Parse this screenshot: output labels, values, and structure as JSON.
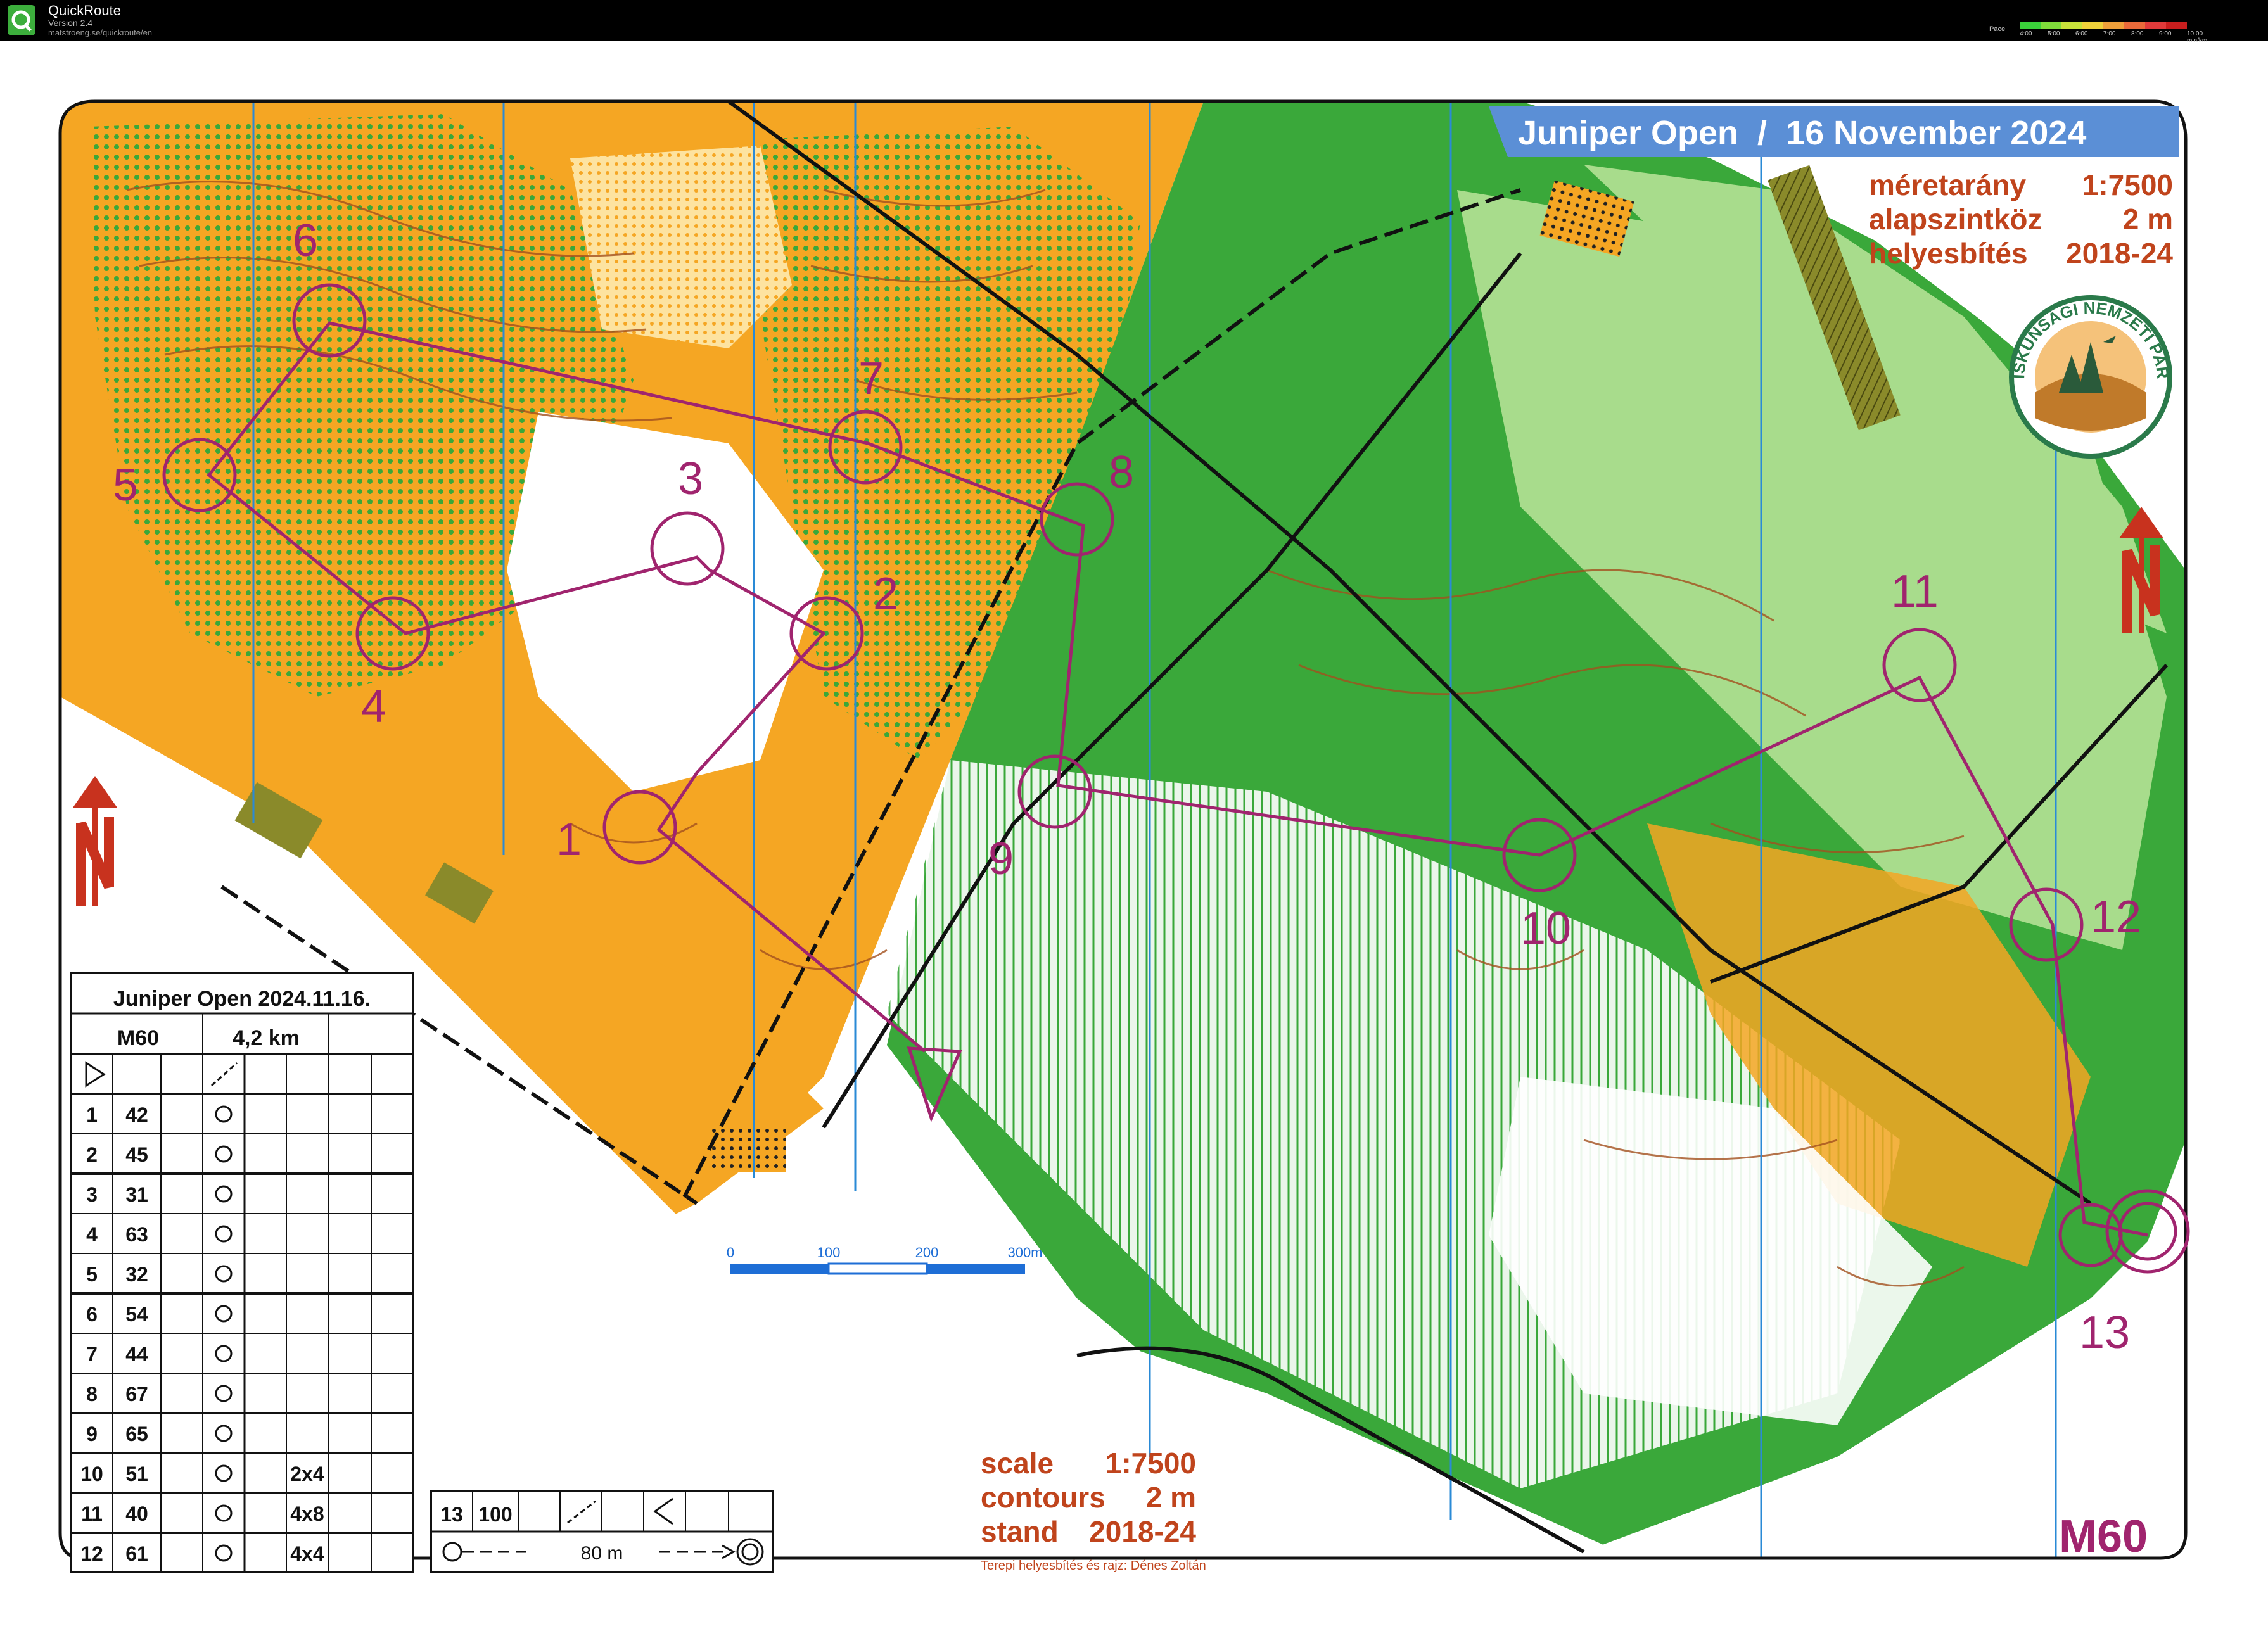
{
  "app": {
    "name": "QuickRoute",
    "version": "Version 2.4",
    "url": "matstroeng.se/quickroute/en",
    "pace_label": "Pace",
    "pace_ticks": [
      "4:00",
      "5:00",
      "6:00",
      "7:00",
      "8:00",
      "9:00",
      "10:00 min/km"
    ],
    "pace_colors": [
      "#3ad13a",
      "#7fdc3a",
      "#c8e23a",
      "#f0d23a",
      "#f0a03a",
      "#ea6a3a",
      "#e03a3a",
      "#c81e1e"
    ]
  },
  "map": {
    "title": "Juniper Open  /  16 November 2024",
    "info_hu": [
      {
        "label": "méretarány",
        "value": "1:7500"
      },
      {
        "label": "alapszintköz",
        "value": "2 m"
      },
      {
        "label": "helyesbítés",
        "value": "2018-24"
      }
    ],
    "info_en": [
      {
        "label": "scale",
        "value": "1:7500"
      },
      {
        "label": "contours",
        "value": "2 m"
      },
      {
        "label": "stand",
        "value": "2018-24"
      }
    ],
    "credit": "Terepi helyesbítés és rajz: Dénes Zoltán",
    "category": "M60",
    "logo_text": "KISKUNSÁGI NEMZETI PARK",
    "scalebar_ticks": [
      "0",
      "100",
      "200",
      "300m"
    ],
    "colors": {
      "orange": "#f5a623",
      "green": "#3aa83a",
      "light_green": "#a8dc8c",
      "course": "#a0246e",
      "contour": "#a2501e",
      "title_bg": "#5b8fd6",
      "brown_text": "#c0441c"
    },
    "controls": [
      {
        "code": "1"
      },
      {
        "code": "2"
      },
      {
        "code": "3"
      },
      {
        "code": "4"
      },
      {
        "code": "5"
      },
      {
        "code": "6"
      },
      {
        "code": "7"
      },
      {
        "code": "8"
      },
      {
        "code": "9"
      },
      {
        "code": "10"
      },
      {
        "code": "11"
      },
      {
        "code": "12"
      },
      {
        "code": "13"
      }
    ]
  },
  "description_sheet": {
    "event": "Juniper Open 2024.11.16.",
    "class": "M60",
    "length": "4,2 km",
    "rows": [
      {
        "num": "1",
        "code": "42",
        "extra": ""
      },
      {
        "num": "2",
        "code": "45",
        "extra": ""
      },
      {
        "num": "3",
        "code": "31",
        "extra": ""
      },
      {
        "num": "4",
        "code": "63",
        "extra": ""
      },
      {
        "num": "5",
        "code": "32",
        "extra": ""
      },
      {
        "num": "6",
        "code": "54",
        "extra": ""
      },
      {
        "num": "7",
        "code": "44",
        "extra": ""
      },
      {
        "num": "8",
        "code": "67",
        "extra": ""
      },
      {
        "num": "9",
        "code": "65",
        "extra": ""
      },
      {
        "num": "10",
        "code": "51",
        "extra": "2x4"
      },
      {
        "num": "11",
        "code": "40",
        "extra": "4x8"
      },
      {
        "num": "12",
        "code": "61",
        "extra": "4x4"
      }
    ],
    "finish": {
      "num": "13",
      "code": "100",
      "distance": "80 m"
    }
  }
}
